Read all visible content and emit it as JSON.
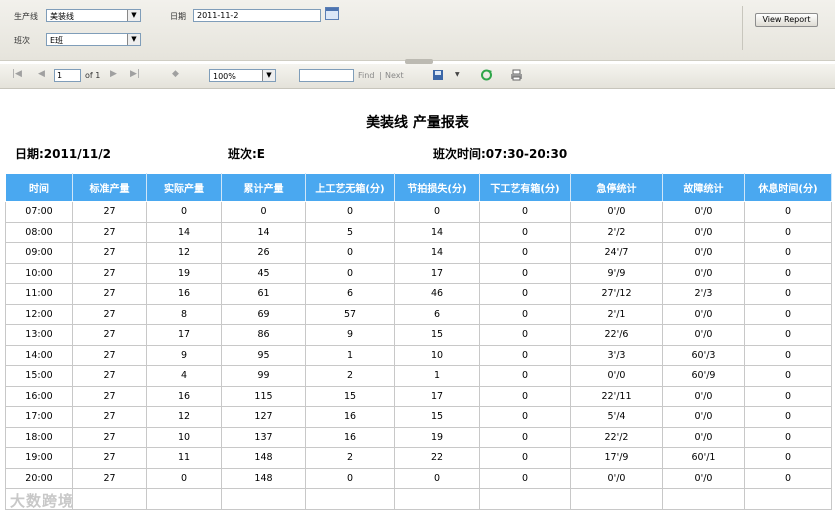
{
  "params": {
    "line_label": "生产线",
    "line_value": "美装线",
    "date_label": "日期",
    "date_value": "2011-11-2",
    "shift_label": "班次",
    "shift_value": "E班",
    "view_report": "View Report"
  },
  "toolbar": {
    "page": "1",
    "of": "of 1",
    "zoom": "100%",
    "find": "Find",
    "sep": "|",
    "next": "Next"
  },
  "report": {
    "title": "美装线 产量报表",
    "date": "日期:2011/11/2",
    "shift": "班次:E",
    "shift_time": "班次时间:07:30-20:30",
    "columns": [
      "时间",
      "标准产量",
      "实际产量",
      "累计产量",
      "上工艺无箱(分)",
      "节拍损失(分)",
      "下工艺有箱(分)",
      "急停统计",
      "故障统计",
      "休息时间(分)"
    ],
    "rows": [
      [
        "07:00",
        "27",
        "0",
        "0",
        "0",
        "0",
        "0",
        "0'/0",
        "0'/0",
        "0"
      ],
      [
        "08:00",
        "27",
        "14",
        "14",
        "5",
        "14",
        "0",
        "2'/2",
        "0'/0",
        "0"
      ],
      [
        "09:00",
        "27",
        "12",
        "26",
        "0",
        "14",
        "0",
        "24'/7",
        "0'/0",
        "0"
      ],
      [
        "10:00",
        "27",
        "19",
        "45",
        "0",
        "17",
        "0",
        "9'/9",
        "0'/0",
        "0"
      ],
      [
        "11:00",
        "27",
        "16",
        "61",
        "6",
        "46",
        "0",
        "27'/12",
        "2'/3",
        "0"
      ],
      [
        "12:00",
        "27",
        "8",
        "69",
        "57",
        "6",
        "0",
        "2'/1",
        "0'/0",
        "0"
      ],
      [
        "13:00",
        "27",
        "17",
        "86",
        "9",
        "15",
        "0",
        "22'/6",
        "0'/0",
        "0"
      ],
      [
        "14:00",
        "27",
        "9",
        "95",
        "1",
        "10",
        "0",
        "3'/3",
        "60'/3",
        "0"
      ],
      [
        "15:00",
        "27",
        "4",
        "99",
        "2",
        "1",
        "0",
        "0'/0",
        "60'/9",
        "0"
      ],
      [
        "16:00",
        "27",
        "16",
        "115",
        "15",
        "17",
        "0",
        "22'/11",
        "0'/0",
        "0"
      ],
      [
        "17:00",
        "27",
        "12",
        "127",
        "16",
        "15",
        "0",
        "5'/4",
        "0'/0",
        "0"
      ],
      [
        "18:00",
        "27",
        "10",
        "137",
        "16",
        "19",
        "0",
        "22'/2",
        "0'/0",
        "0"
      ],
      [
        "19:00",
        "27",
        "11",
        "148",
        "2",
        "22",
        "0",
        "17'/9",
        "60'/1",
        "0"
      ],
      [
        "20:00",
        "27",
        "0",
        "148",
        "0",
        "0",
        "0",
        "0'/0",
        "0'/0",
        "0"
      ],
      [
        "",
        "",
        "",
        "",
        "",
        "",
        "",
        "",
        "",
        ""
      ]
    ]
  },
  "watermark": "大数跨境"
}
